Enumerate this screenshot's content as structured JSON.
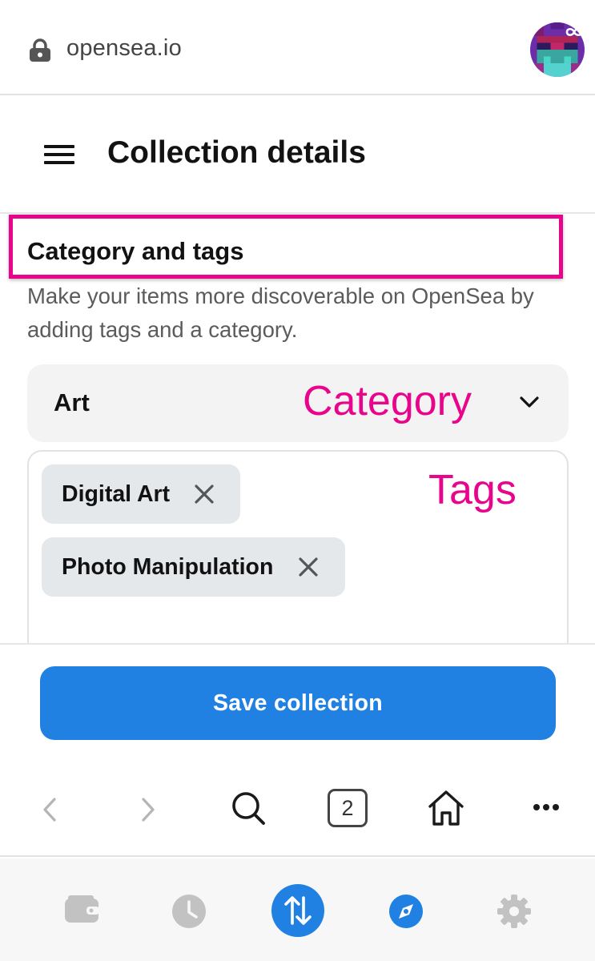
{
  "browser": {
    "url": "opensea.io",
    "tab_count": "2"
  },
  "header": {
    "title": "Collection details"
  },
  "section": {
    "heading": "Category and tags",
    "description": "Make your items more discoverable on OpenSea by adding tags and a category."
  },
  "category": {
    "value": "Art"
  },
  "tags": [
    {
      "label": "Digital Art"
    },
    {
      "label": "Photo Manipulation"
    }
  ],
  "annotations": {
    "category": "Category",
    "tags": "Tags"
  },
  "actions": {
    "save_label": "Save collection"
  },
  "colors": {
    "accent": "#2081e2",
    "annotation": "#e9048c",
    "chip": "#e5e8eb"
  },
  "icons": {
    "urlbar": [
      "lock-icon",
      "avatar"
    ],
    "header": [
      "hamburger-menu-icon"
    ],
    "browser_bar": [
      "back-arrow-icon",
      "forward-arrow-icon",
      "search-icon",
      "tabs-icon",
      "home-icon",
      "more-icon"
    ],
    "wallet_nav": [
      "wallet-icon",
      "history-icon",
      "swap-icon",
      "explore-icon",
      "settings-icon"
    ]
  }
}
